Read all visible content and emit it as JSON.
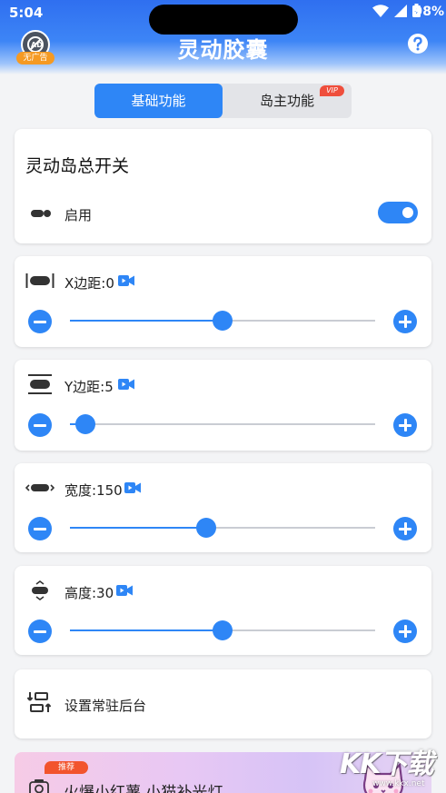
{
  "status": {
    "time": "5:04",
    "battery": "98%"
  },
  "header": {
    "title": "灵动胶囊",
    "no_ad_badge": "无广告"
  },
  "tabs": [
    {
      "label": "基础功能",
      "active": true
    },
    {
      "label": "岛主功能",
      "active": false,
      "badge": "VIP"
    }
  ],
  "master": {
    "title": "灵动岛总开关",
    "enable_label": "启用",
    "enabled": true
  },
  "sliders": [
    {
      "label": "X边距:0",
      "icon": "horizontal-margin-icon",
      "value_fraction": 0.5
    },
    {
      "label": "Y边距:5",
      "icon": "vertical-margin-icon",
      "value_fraction": 0.05
    },
    {
      "label": "宽度:150",
      "icon": "width-icon",
      "value_fraction": 0.445
    },
    {
      "label": "高度:30",
      "icon": "height-icon",
      "value_fraction": 0.5
    }
  ],
  "background": {
    "label": "设置常驻后台"
  },
  "promo": {
    "badge": "推荐",
    "text": "火爆小红薯 小猫补光灯"
  },
  "watermark": {
    "text": "KK下载",
    "sub": "www.kkx.net"
  },
  "colors": {
    "accent": "#2e86f6",
    "header": "#3d85f6",
    "vip": "#ef4e3c",
    "badge": "#f59a23"
  }
}
